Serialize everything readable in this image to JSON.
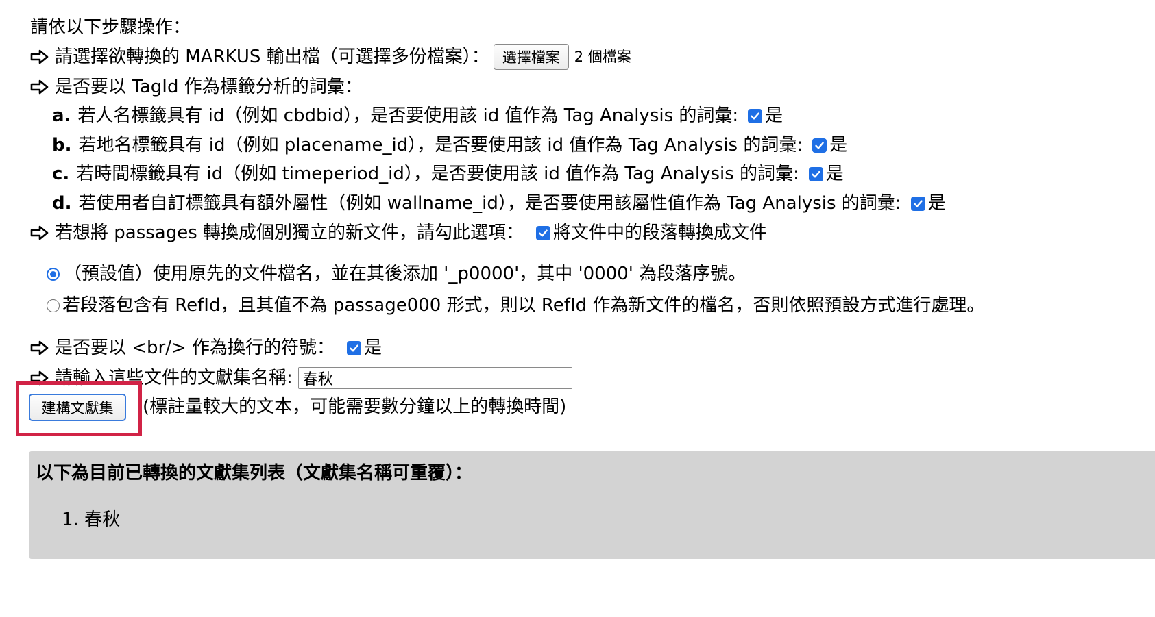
{
  "intro": "請依以下步驟操作：",
  "step_file": {
    "label": "請選擇欲轉換的 MARKUS 輸出檔（可選擇多份檔案）：",
    "button_label": "選擇檔案",
    "file_count": "2 個檔案"
  },
  "step_tagid": {
    "label": "是否要以 TagId 作為標籤分析的詞彙：",
    "options": [
      {
        "key": "a.",
        "text": "若人名標籤具有 id（例如 cbdbid），是否要使用該 id 值作為 Tag Analysis 的詞彙:",
        "check_label": "是",
        "checked": true
      },
      {
        "key": "b.",
        "text": "若地名標籤具有 id（例如 placename_id），是否要使用該 id 值作為 Tag Analysis 的詞彙:",
        "check_label": "是",
        "checked": true
      },
      {
        "key": "c.",
        "text": "若時間標籤具有 id（例如 timeperiod_id），是否要使用該 id 值作為 Tag Analysis 的詞彙:",
        "check_label": "是",
        "checked": true
      },
      {
        "key": "d.",
        "text": "若使用者自訂標籤具有額外屬性（例如 wallname_id），是否要使用該屬性值作為 Tag Analysis 的詞彙:",
        "check_label": "是",
        "checked": true
      }
    ]
  },
  "step_passages": {
    "label": "若想將 passages 轉換成個別獨立的新文件，請勾此選項：",
    "check_label": "將文件中的段落轉換成文件",
    "checked": true
  },
  "naming_options": [
    {
      "text": "（預設值）使用原先的文件檔名，並在其後添加 '_p0000'，其中 '0000' 為段落序號。",
      "selected": true
    },
    {
      "text": "若段落包含有 RefId，且其值不為 passage000 形式，則以 RefId 作為新文件的檔名，否則依照預設方式進行處理。",
      "selected": false
    }
  ],
  "step_br": {
    "label": "是否要以 <br/> 作為換行的符號：",
    "check_label": "是",
    "checked": true
  },
  "step_name": {
    "label": "請輸入這些文件的文獻集名稱:",
    "value": "春秋"
  },
  "build": {
    "button_label": "建構文獻集",
    "note": "(標註量較大的文本，可能需要數分鐘以上的轉換時間)"
  },
  "collection_list": {
    "title": "以下為目前已轉換的文獻集列表（文獻集名稱可重覆）：",
    "items": [
      "1. 春秋"
    ]
  },
  "colors": {
    "accent": "#1f6fe5",
    "highlight": "#d12346",
    "panel": "#d3d3d3"
  }
}
